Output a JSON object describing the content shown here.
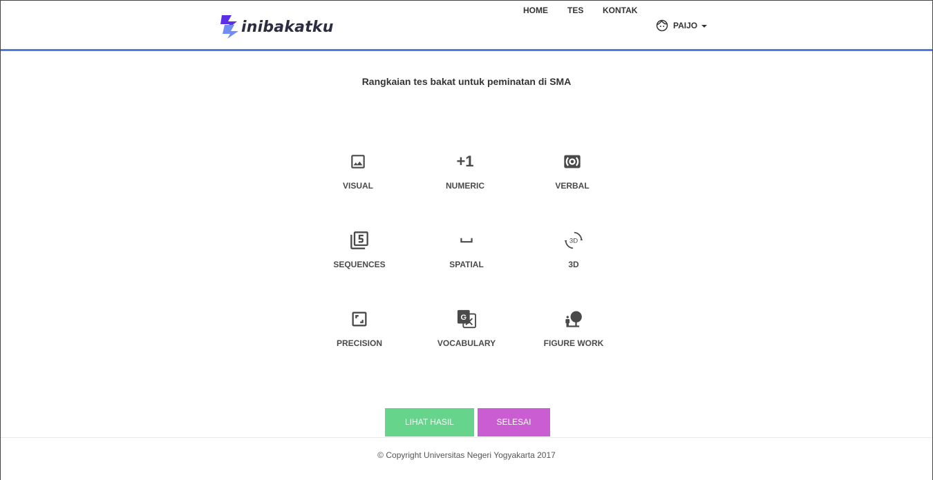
{
  "brand": {
    "name": "inibakatku"
  },
  "nav": {
    "items": [
      {
        "label": "HOME"
      },
      {
        "label": "TES"
      },
      {
        "label": "KONTAK"
      }
    ],
    "user": {
      "name": "PAIJO",
      "icon": "face-icon"
    }
  },
  "main": {
    "subtitle": "Rangkaian tes bakat untuk peminatan di SMA",
    "tests": [
      {
        "label": "VISUAL",
        "icon": "image-icon"
      },
      {
        "label": "NUMERIC",
        "icon": "plus-one-icon",
        "icon_text": "+1"
      },
      {
        "label": "VERBAL",
        "icon": "surround-sound-icon"
      },
      {
        "label": "SEQUENCES",
        "icon": "filter-5-icon"
      },
      {
        "label": "SPATIAL",
        "icon": "space-bar-icon"
      },
      {
        "label": "3D",
        "icon": "3d-rotation-icon"
      },
      {
        "label": "PRECISION",
        "icon": "crop-free-icon"
      },
      {
        "label": "VOCABULARY",
        "icon": "translate-icon"
      },
      {
        "label": "FIGURE WORK",
        "icon": "nature-people-icon"
      }
    ]
  },
  "actions": {
    "view_results": "LIHAT HASIL",
    "finish": "SELESAI"
  },
  "footer": {
    "copyright": "© Copyright Universitas Negeri Yogyakarta 2017"
  },
  "colors": {
    "nav_border": "#4a7be0",
    "brand_logo_primary": "#5b2ee8",
    "brand_logo_secondary": "#6f8df2",
    "button_green": "#66d48a",
    "button_purple": "#c95dd1",
    "icon": "#4a4a4a"
  }
}
